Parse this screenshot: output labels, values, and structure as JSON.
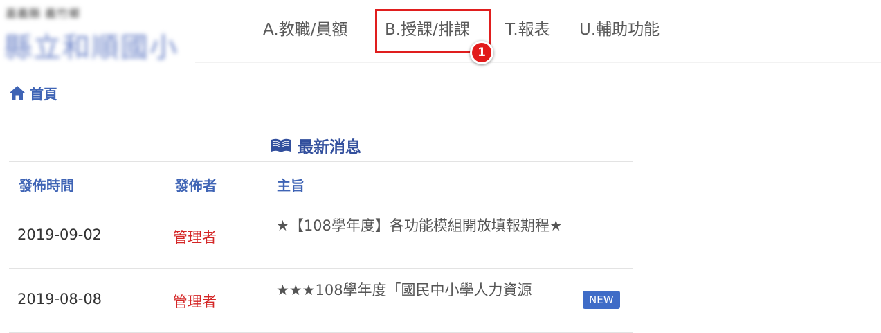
{
  "brand": {
    "subtitle": "嘉義縣 義竹鄉",
    "school_name": "縣立和順國小"
  },
  "nav": {
    "items": [
      {
        "label": "A.教職/員額"
      },
      {
        "label": "B.授課/排課"
      },
      {
        "label": "T.報表"
      },
      {
        "label": "U.輔助功能"
      }
    ]
  },
  "annotation": {
    "badge": "1",
    "color": "#e01e1e"
  },
  "breadcrumb": {
    "home_icon": "home-icon",
    "label": "首頁"
  },
  "news": {
    "icon": "book-icon",
    "title": "最新消息",
    "columns": [
      "發佈時間",
      "發佈者",
      "主旨"
    ],
    "rows": [
      {
        "date": "2019-09-02",
        "publisher": "管理者",
        "subject": "★【108學年度】各功能模組開放填報期程★",
        "badge": ""
      },
      {
        "date": "2019-08-08",
        "publisher": "管理者",
        "subject": "★★★108學年度「國民中小學人力資源",
        "badge": "NEW"
      }
    ]
  },
  "colors": {
    "link_blue": "#3f64b5",
    "publisher_red": "#d42626",
    "new_badge": "#3f6cc7"
  }
}
